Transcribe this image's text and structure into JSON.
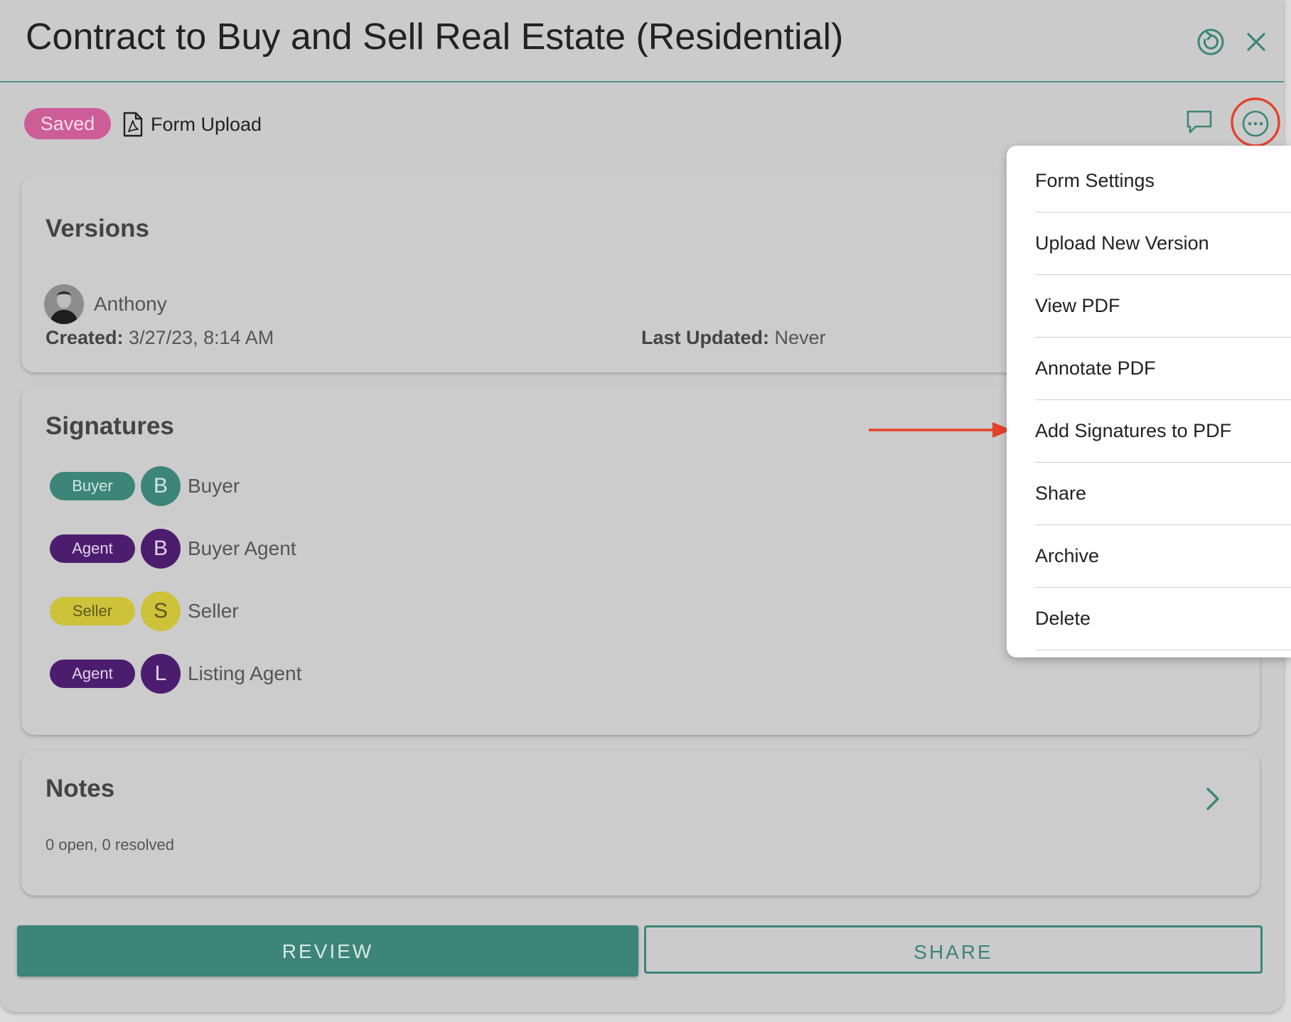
{
  "header": {
    "title": "Contract to Buy and Sell Real Estate (Residential)",
    "refresh_icon": "refresh-icon",
    "close_icon": "close-icon"
  },
  "toolbar": {
    "status_badge": "Saved",
    "form_type_label": "Form Upload",
    "form_type_icon": "pdf-file-icon",
    "comment_icon": "comment-icon",
    "more_icon": "more-options-icon"
  },
  "versions": {
    "title": "Versions",
    "author": "Anthony",
    "created_label": "Created:",
    "created_value": "3/27/23, 8:14 AM",
    "updated_label": "Last Updated:",
    "updated_value": "Never"
  },
  "signatures": {
    "title": "Signatures",
    "items": [
      {
        "role": "Buyer",
        "initial": "B",
        "name": "Buyer",
        "color": "#3c8578"
      },
      {
        "role": "Agent",
        "initial": "B",
        "name": "Buyer Agent",
        "color": "#4c1d6e"
      },
      {
        "role": "Seller",
        "initial": "S",
        "name": "Seller",
        "color": "#cdc23a"
      },
      {
        "role": "Agent",
        "initial": "L",
        "name": "Listing Agent",
        "color": "#4c1d6e"
      }
    ]
  },
  "notes": {
    "title": "Notes",
    "summary": "0 open, 0 resolved"
  },
  "actions": {
    "review_label": "REVIEW",
    "share_label": "SHARE"
  },
  "menu": {
    "items": [
      "Form Settings",
      "Upload New Version",
      "View PDF",
      "Annotate PDF",
      "Add Signatures to PDF",
      "Share",
      "Archive",
      "Delete"
    ]
  },
  "colors": {
    "accent": "#3c8578",
    "saved_badge": "#cc5d97",
    "annotation": "#e5412b"
  }
}
